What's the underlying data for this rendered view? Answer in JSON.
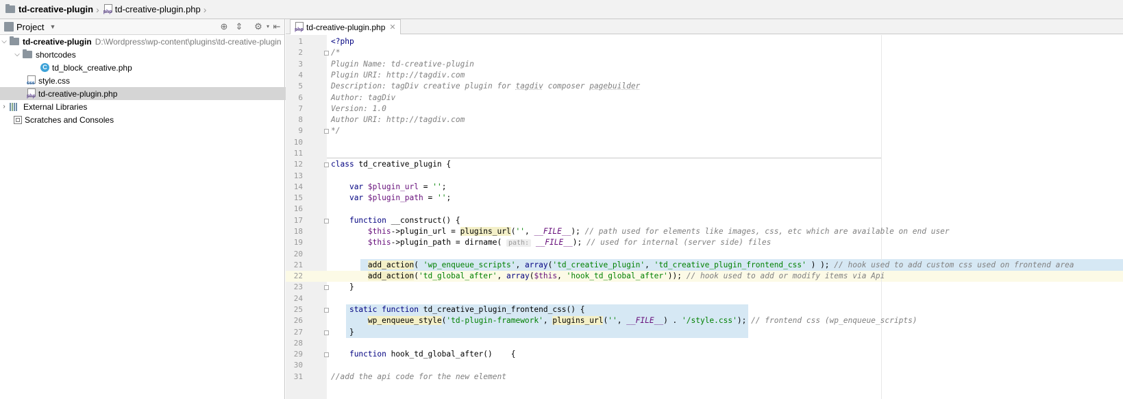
{
  "breadcrumb": {
    "project": "td-creative-plugin",
    "file": "td-creative-plugin.php"
  },
  "project_panel": {
    "title": "Project",
    "tree": [
      {
        "label": "td-creative-plugin",
        "path": "D:\\Wordpress\\wp-content\\plugins\\td-creative-plugin",
        "icon": "folder-icon",
        "expanded": true
      },
      {
        "label": "shortcodes",
        "icon": "folder-icon",
        "expanded": true
      },
      {
        "label": "td_block_creative.php",
        "icon": "php-class-icon"
      },
      {
        "label": "style.css",
        "icon": "css-file-icon"
      },
      {
        "label": "td-creative-plugin.php",
        "icon": "php-file-icon",
        "selected": true
      },
      {
        "label": "External Libraries",
        "icon": "library-icon",
        "expanded": false
      },
      {
        "label": "Scratches and Consoles",
        "icon": "scratch-icon"
      }
    ]
  },
  "editor": {
    "tab_label": "td-creative-plugin.php",
    "line_numbers": [
      "1",
      "2",
      "3",
      "4",
      "5",
      "6",
      "7",
      "8",
      "9",
      "10",
      "11",
      "12",
      "13",
      "14",
      "15",
      "16",
      "17",
      "18",
      "19",
      "20",
      "21",
      "22",
      "23",
      "24",
      "25",
      "26",
      "27",
      "28",
      "29",
      "30",
      "31"
    ],
    "comment_block": [
      "/*",
      "Plugin Name: td-creative-plugin",
      "Plugin URI: http://tagdiv.com",
      "Author: tagDiv",
      "Version: 1.0",
      "Author URI: http://tagdiv.com",
      "*/"
    ],
    "desc_prefix": "Description: tagDiv creative plugin for ",
    "desc_tagdiv": "tagdiv",
    "desc_mid": " composer ",
    "desc_pagebuilder": "pagebuilder",
    "php_open": "<?php",
    "hint_path": "path:",
    "comment_line18": "// path used for elements like images, css, etc which are available on end user",
    "comment_line19": "// used for internal (server side) files",
    "comment_line21": "// hook used to add custom css used on frontend area",
    "comment_line22": "// hook used to add or modify items via Api",
    "comment_line26": "// frontend css (wp_enqueue_scripts)",
    "comment_line31": "//add the api code for the new element"
  }
}
